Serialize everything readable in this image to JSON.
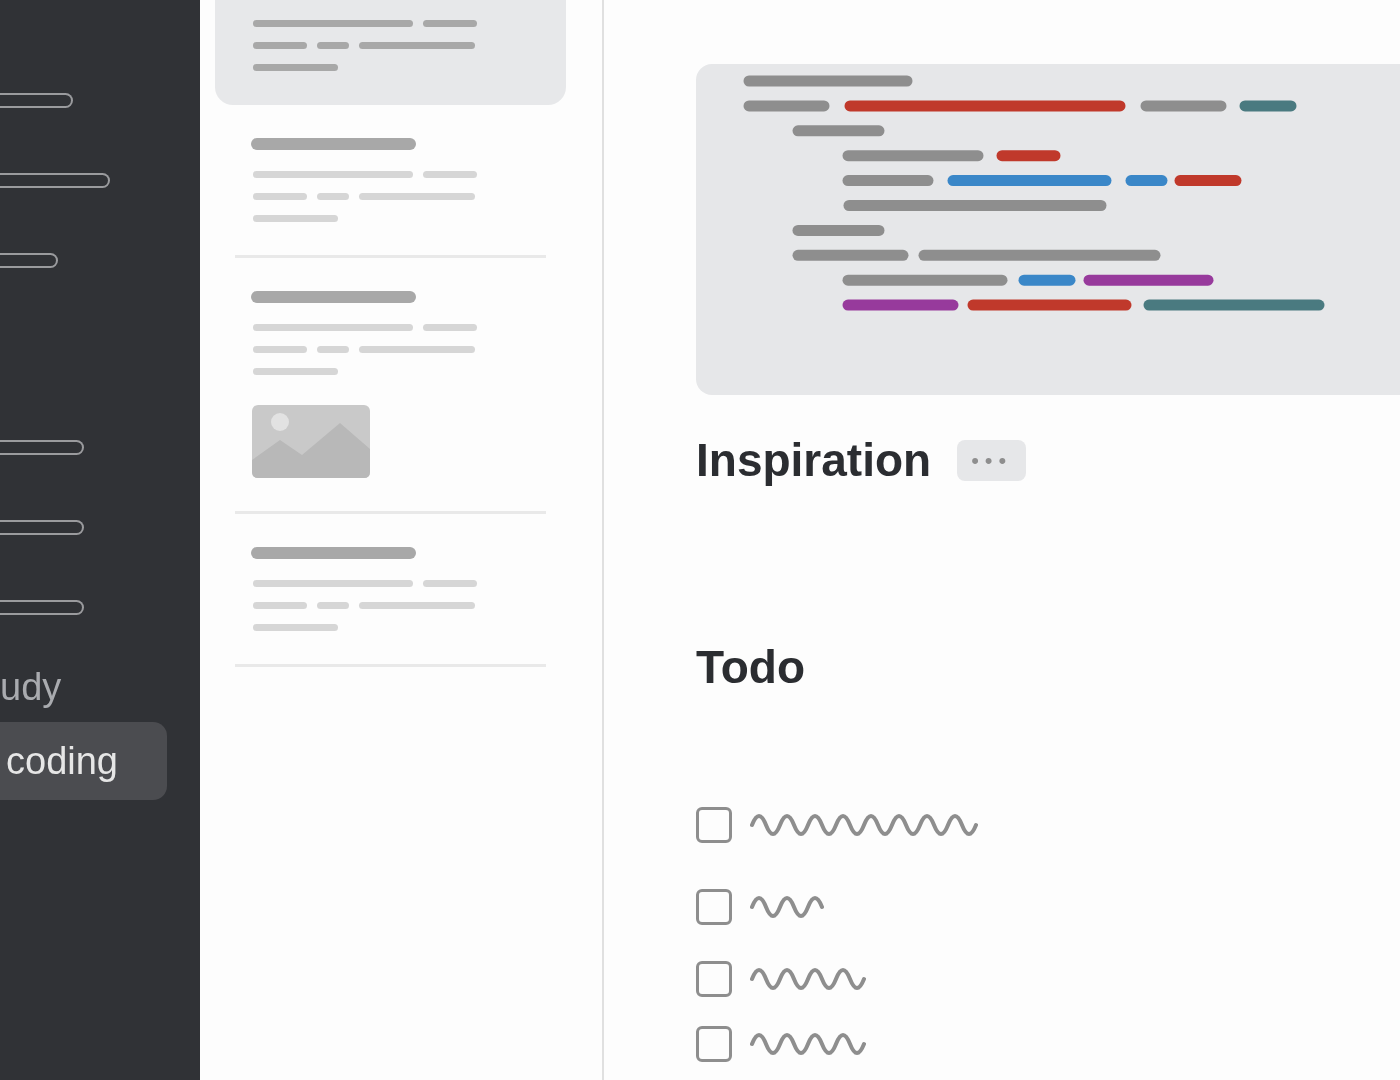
{
  "sidebar": {
    "items": [
      {
        "label": "udy",
        "selected": false
      },
      {
        "label": "coding",
        "selected": true
      }
    ]
  },
  "notes": [
    {
      "kind": "text",
      "selected": true
    },
    {
      "kind": "text",
      "selected": false
    },
    {
      "kind": "picture",
      "selected": false
    },
    {
      "kind": "text",
      "selected": false
    }
  ],
  "editor": {
    "heading": "Inspiration",
    "tag": "•••",
    "todo_heading": "Todo",
    "todos": [
      {
        "checked": false
      },
      {
        "checked": false
      },
      {
        "checked": false
      },
      {
        "checked": false
      }
    ]
  }
}
